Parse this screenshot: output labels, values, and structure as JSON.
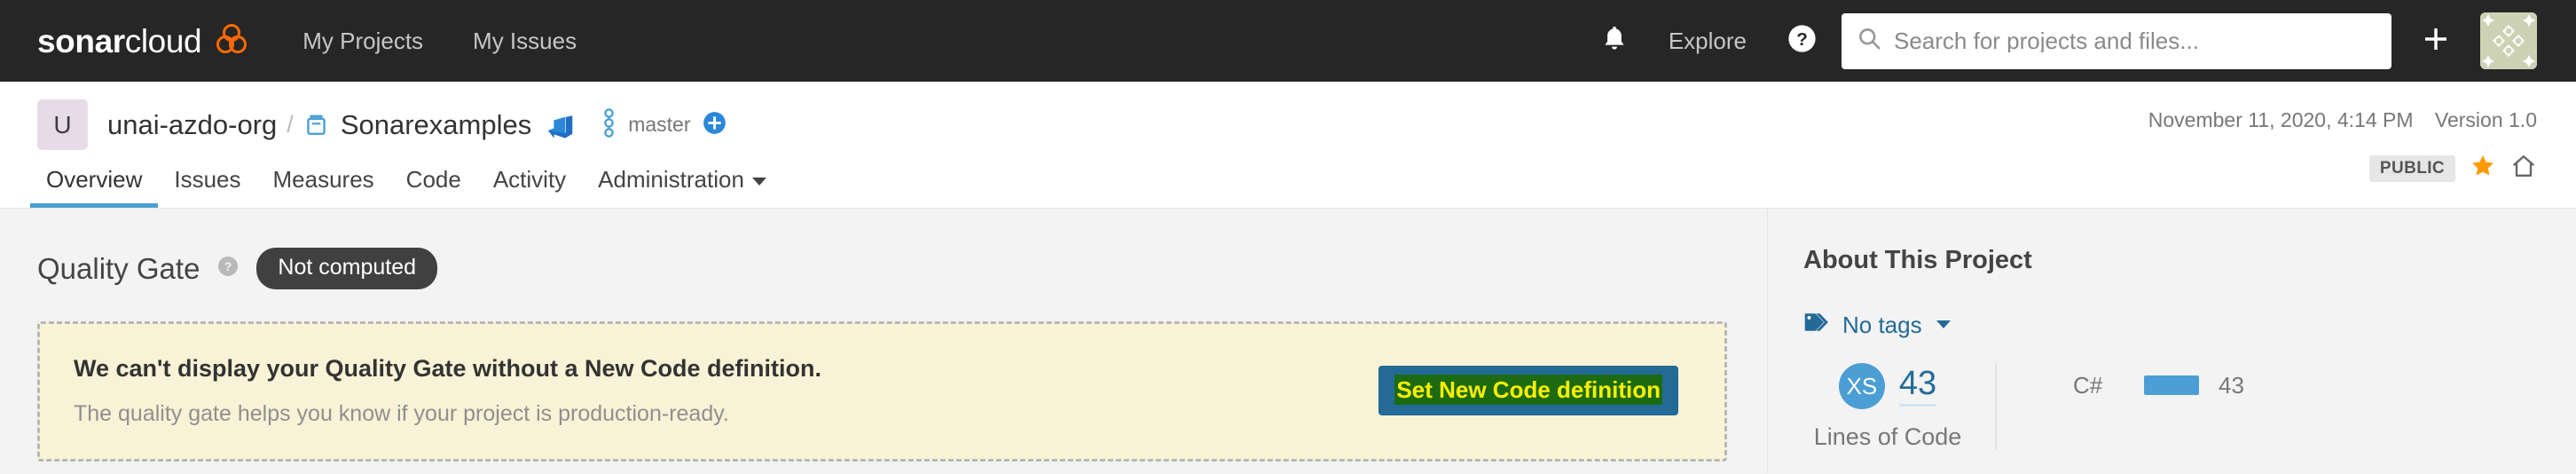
{
  "global_nav": {
    "brand": {
      "bold": "sonar",
      "light": "cloud",
      "logo_icon": "sonarcloud-logo-icon"
    },
    "links": [
      {
        "label": "My Projects",
        "name": "nav-link-my-projects"
      },
      {
        "label": "My Issues",
        "name": "nav-link-my-issues"
      }
    ],
    "notifications_icon": "bell-icon",
    "explore_label": "Explore",
    "help_icon": "help-circle-icon",
    "search": {
      "icon": "search-icon",
      "placeholder": "Search for projects and files...",
      "value": ""
    },
    "create_icon": "plus-icon",
    "avatar_icon": "user-avatar-identicon"
  },
  "project_header": {
    "org_initial": "U",
    "org_name": "unai-azdo-org",
    "separator": "/",
    "qualifier_icon": "project-qualifier-icon",
    "project_name": "Sonarexamples",
    "alm_icon": "azure-devops-icon",
    "branch_icon": "branch-icon",
    "branch_name": "master",
    "branch_add_icon": "add-branch-icon",
    "analysis_date": "November 11, 2020, 4:14 PM",
    "version": "Version 1.0",
    "visibility": "PUBLIC",
    "favorite_icon": "star-favorite-icon",
    "homepage_icon": "home-icon",
    "tabs": [
      {
        "label": "Overview",
        "active": true
      },
      {
        "label": "Issues",
        "active": false
      },
      {
        "label": "Measures",
        "active": false
      },
      {
        "label": "Code",
        "active": false
      },
      {
        "label": "Activity",
        "active": false
      },
      {
        "label": "Administration",
        "active": false,
        "has_caret": true
      }
    ]
  },
  "quality_gate": {
    "title": "Quality Gate",
    "help_icon": "help-circle-icon",
    "status_badge": "Not computed",
    "alert": {
      "title": "We can't display your Quality Gate without a New Code definition.",
      "subtitle": "The quality gate helps you know if your project is production-ready.",
      "button_label": "Set New Code definition",
      "button_bg": "#236a97",
      "button_highlight_bg": "#1c6b10",
      "button_highlight_text": "#ffef00",
      "alert_bg": "#f8f3d6"
    }
  },
  "about_project": {
    "title": "About This Project",
    "tags_icon": "tag-icon",
    "tags_label": "No tags",
    "size_rating": "XS",
    "lines_of_code_value": "43",
    "lines_of_code_label": "Lines of Code",
    "languages": [
      {
        "name": "C#",
        "value": "43",
        "bar_pct": 100,
        "color": "#4b9fd5"
      }
    ]
  },
  "colors": {
    "nav_bg": "#262626",
    "accent_blue": "#4b9fd5",
    "link_blue": "#236a97",
    "page_bg": "#f3f3f3",
    "brand_orange": "#fd6a00"
  }
}
